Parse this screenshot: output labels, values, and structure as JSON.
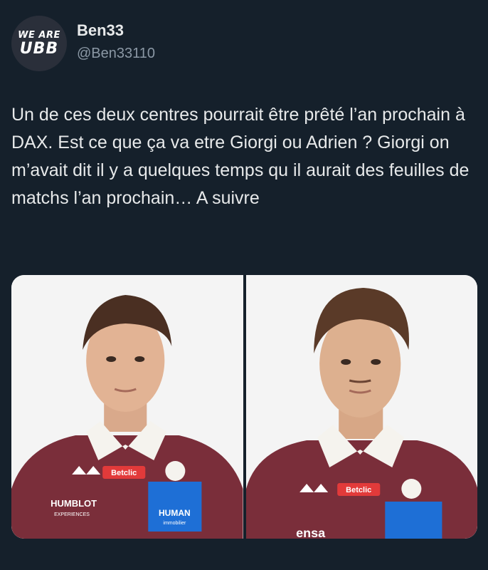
{
  "tweet": {
    "avatar": {
      "line1": "WE ARE",
      "line2": "UBB"
    },
    "display_name": "Ben33",
    "handle": "@Ben33110",
    "text": "Un de ces deux centres pourrait être prêté l’an prochain à DAX. Est ce que ça va etre Giorgi ou Adrien ? Giorgi on m’avait dit il y a quelques temps qu il aurait des feuilles de matchs l’an prochain… A suivre"
  },
  "media": {
    "left": {
      "brand": "Betclic",
      "sponsor1": "HUMBLOT",
      "sponsor1_sub": "EXPERIENCES",
      "sponsor2": "HUMAN",
      "sponsor2_sub": "immobilier"
    },
    "right": {
      "brand": "Betclic",
      "sponsor3": "ensa"
    }
  },
  "colors": {
    "background": "#15202b",
    "jersey": "#7a2e3a",
    "collar": "#f5f3ee",
    "accent_blue": "#1e6fd6"
  }
}
